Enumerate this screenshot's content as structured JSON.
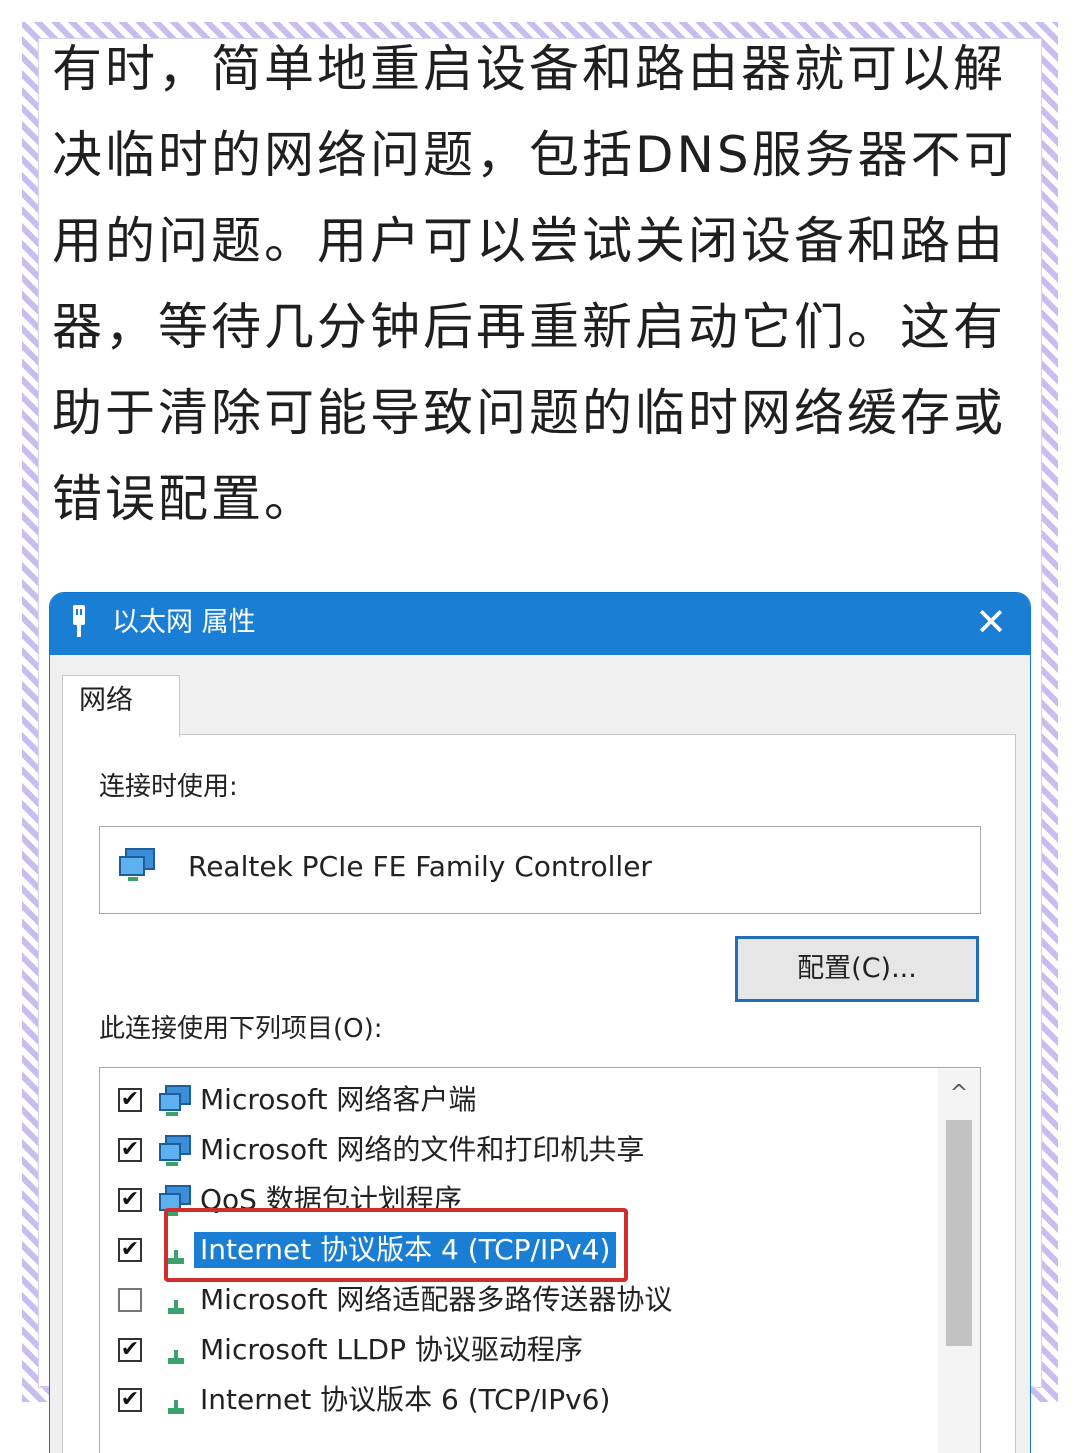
{
  "article": {
    "paragraph": "有时，简单地重启设备和路由器就可以解决临时的网络问题，包括DNS服务器不可用的问题。用户可以尝试关闭设备和路由器，等待几分钟后再重新启动它们。这有助于清除可能导致问题的临时网络缓存或错误配置。"
  },
  "dialog": {
    "title": "以太网 属性",
    "close_label": "✕",
    "tab_label": "网络",
    "connect_using_label": "连接时使用:",
    "adapter_name": "Realtek PCIe FE Family Controller",
    "config_button": "配置(C)...",
    "items_label": "此连接使用下列项目(O):",
    "items": [
      {
        "label": "Microsoft 网络客户端",
        "checked": true,
        "icon": "network-client-icon"
      },
      {
        "label": "Microsoft 网络的文件和打印机共享",
        "checked": true,
        "icon": "file-share-icon"
      },
      {
        "label": "QoS 数据包计划程序",
        "checked": true,
        "icon": "qos-icon"
      },
      {
        "label": "Internet 协议版本 4 (TCP/IPv4)",
        "checked": true,
        "selected": true,
        "icon": "protocol-icon"
      },
      {
        "label": "Microsoft 网络适配器多路传送器协议",
        "checked": false,
        "icon": "protocol-icon"
      },
      {
        "label": "Microsoft LLDP 协议驱动程序",
        "checked": true,
        "icon": "protocol-icon"
      },
      {
        "label": "Internet 协议版本 6 (TCP/IPv6)",
        "checked": true,
        "icon": "protocol-icon"
      }
    ],
    "checkmark": "✔",
    "scroll_up": "^"
  },
  "colors": {
    "titlebar": "#1a7fd4",
    "highlight_box": "#d22d2d",
    "frame": "#c9bdf0"
  }
}
